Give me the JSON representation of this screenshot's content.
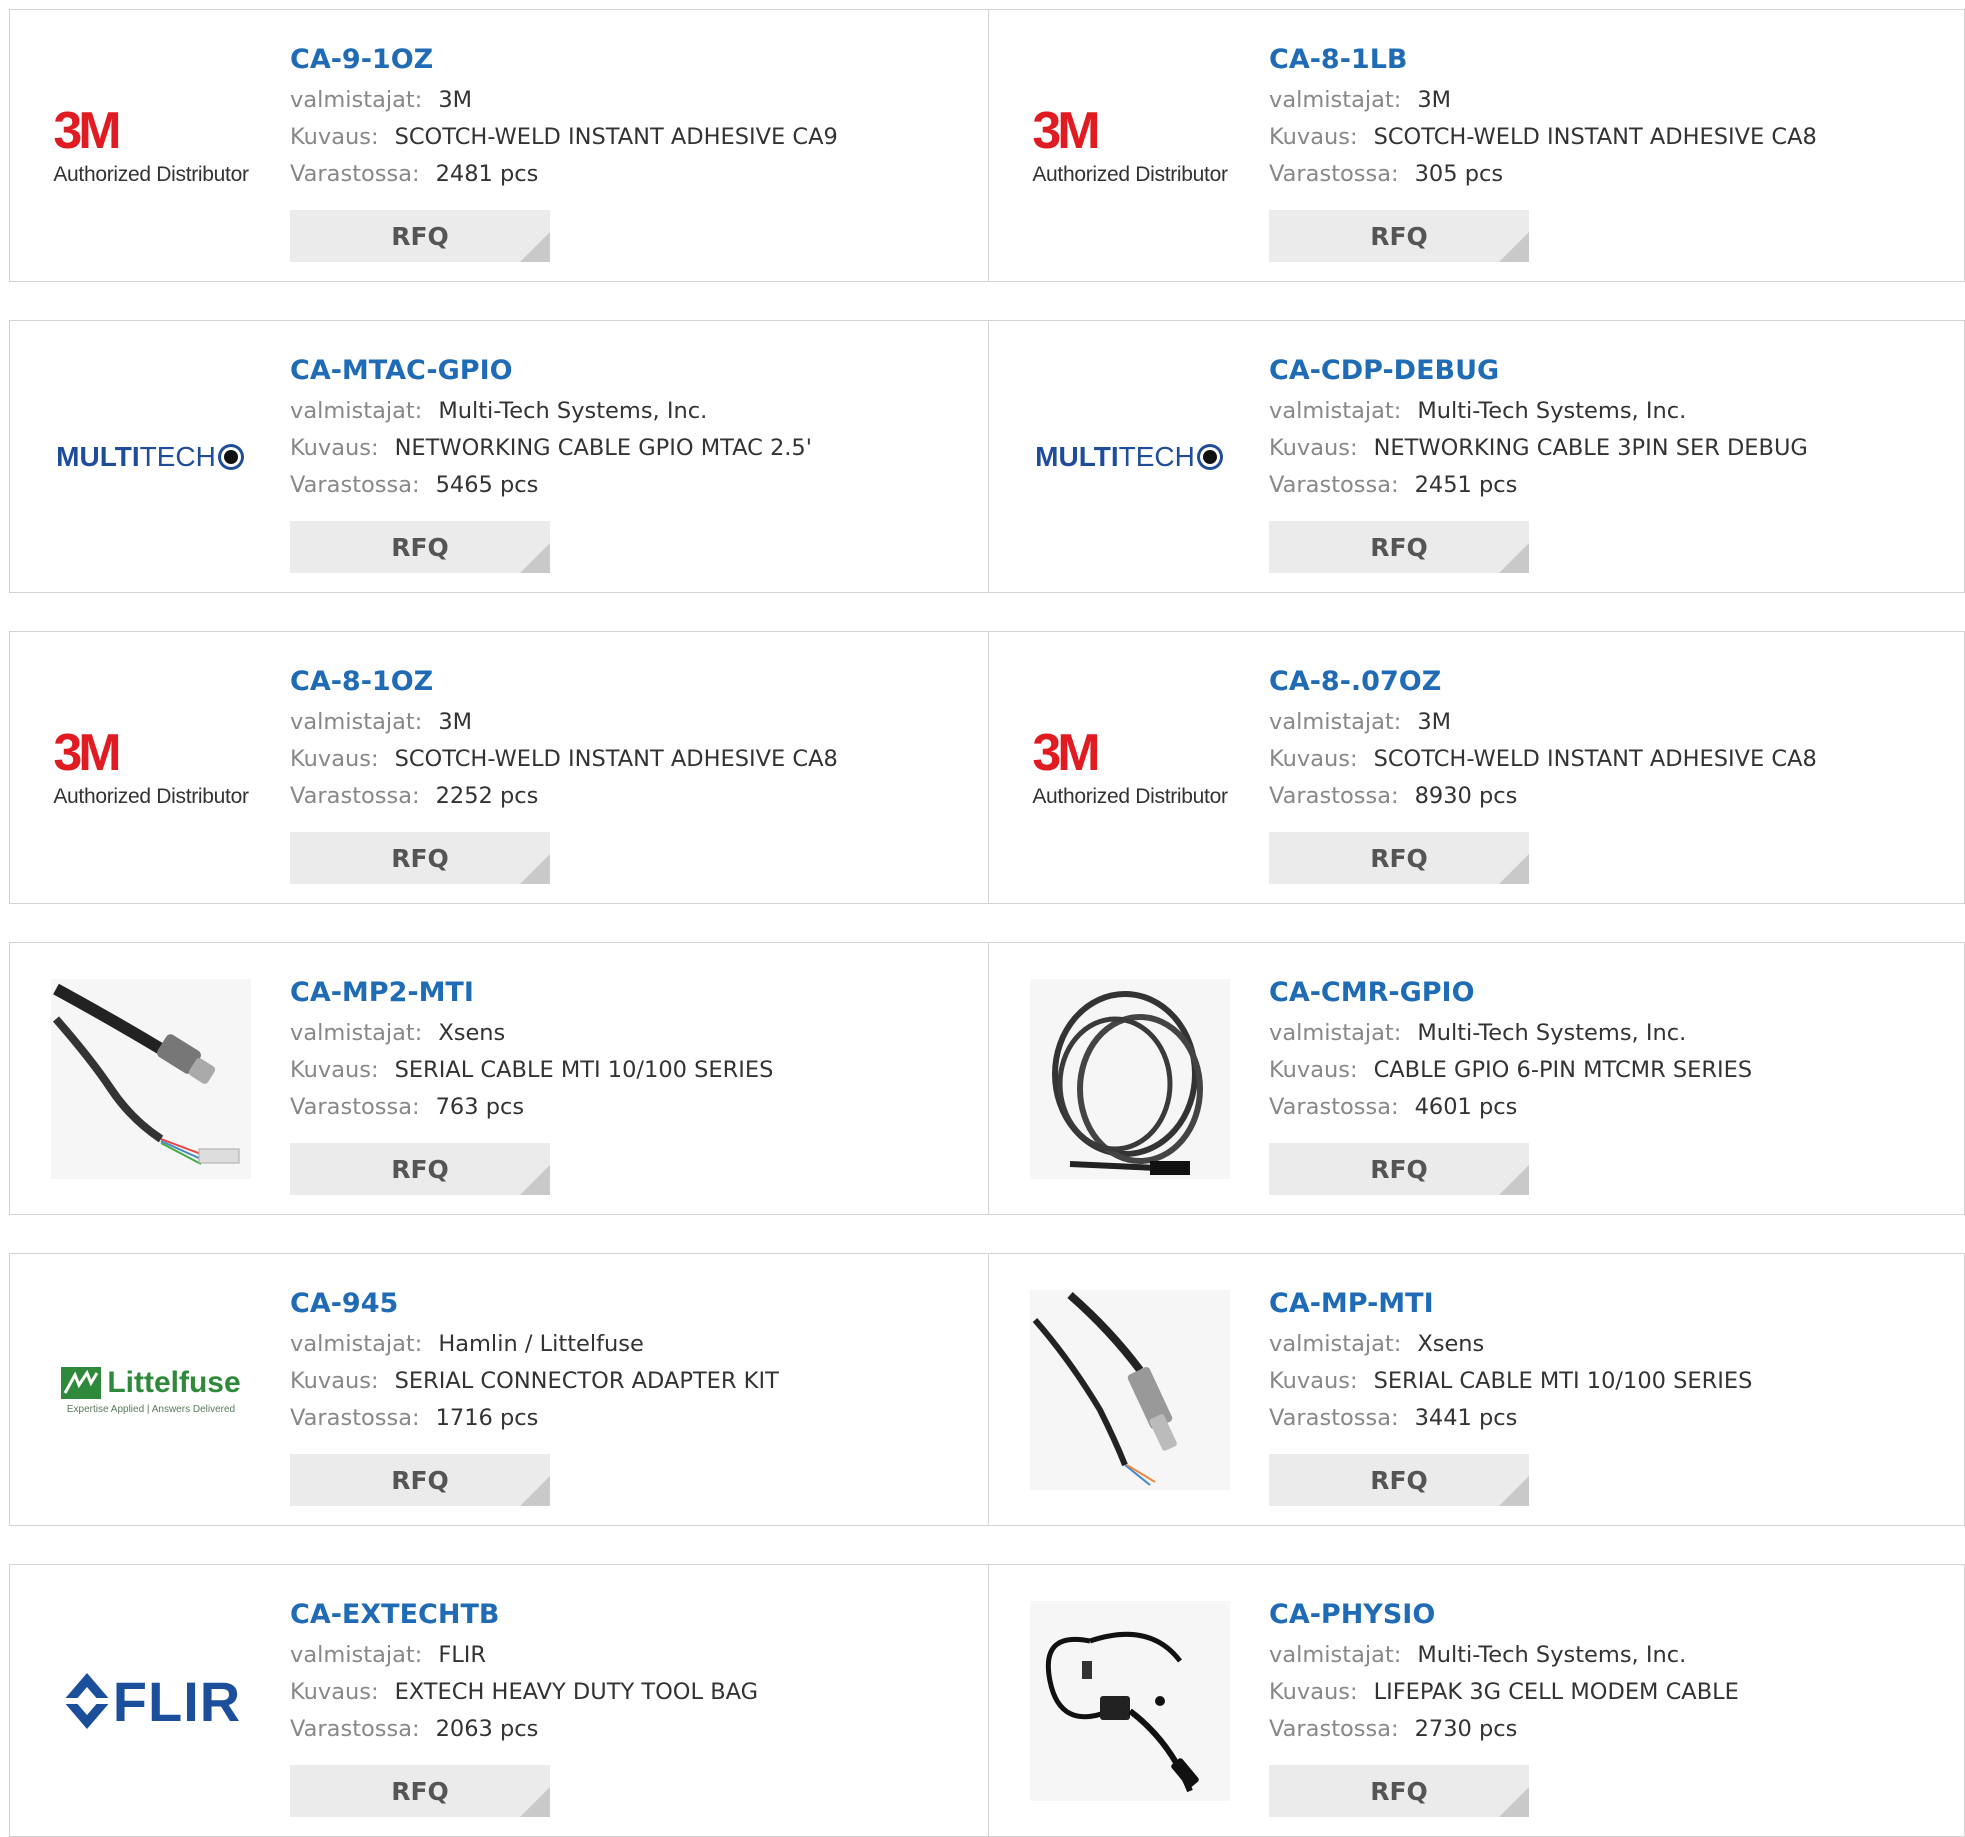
{
  "labels": {
    "manufacturer": "valmistajat:",
    "description": "Kuvaus:",
    "stock": "Varastossa:",
    "rfq": "RFQ"
  },
  "products": [
    {
      "pn": "CA-9-1OZ",
      "manufacturer": "3M",
      "description": "SCOTCH-WELD INSTANT ADHESIVE CA9",
      "stock": "2481 pcs",
      "logo": "3m-logo",
      "logo_text": [
        "3M",
        "Authorized Distributor"
      ]
    },
    {
      "pn": "CA-8-1LB",
      "manufacturer": "3M",
      "description": "SCOTCH-WELD INSTANT ADHESIVE CA8",
      "stock": "305 pcs",
      "logo": "3m-logo",
      "logo_text": [
        "3M",
        "Authorized Distributor"
      ]
    },
    {
      "pn": "CA-MTAC-GPIO",
      "manufacturer": "Multi-Tech Systems, Inc.",
      "description": "NETWORKING CABLE GPIO MTAC 2.5'",
      "stock": "5465 pcs",
      "logo": "multitech-logo",
      "logo_text": [
        "MULTI",
        "TECH"
      ]
    },
    {
      "pn": "CA-CDP-DEBUG",
      "manufacturer": "Multi-Tech Systems, Inc.",
      "description": "NETWORKING CABLE 3PIN SER DEBUG",
      "stock": "2451 pcs",
      "logo": "multitech-logo",
      "logo_text": [
        "MULTI",
        "TECH"
      ]
    },
    {
      "pn": "CA-8-1OZ",
      "manufacturer": "3M",
      "description": "SCOTCH-WELD INSTANT ADHESIVE CA8",
      "stock": "2252 pcs",
      "logo": "3m-logo",
      "logo_text": [
        "3M",
        "Authorized Distributor"
      ]
    },
    {
      "pn": "CA-8-.07OZ",
      "manufacturer": "3M",
      "description": "SCOTCH-WELD INSTANT ADHESIVE CA8",
      "stock": "8930 pcs",
      "logo": "3m-logo",
      "logo_text": [
        "3M",
        "Authorized Distributor"
      ]
    },
    {
      "pn": "CA-MP2-MTI",
      "manufacturer": "Xsens",
      "description": "SERIAL CABLE MTI 10/100 SERIES",
      "stock": "763 pcs",
      "logo": "cable-photo-a"
    },
    {
      "pn": "CA-CMR-GPIO",
      "manufacturer": "Multi-Tech Systems, Inc.",
      "description": "CABLE GPIO 6-PIN MTCMR SERIES",
      "stock": "4601 pcs",
      "logo": "coiled-cable-photo"
    },
    {
      "pn": "CA-945",
      "manufacturer": "Hamlin / Littelfuse",
      "description": "SERIAL CONNECTOR ADAPTER KIT",
      "stock": "1716 pcs",
      "logo": "littelfuse-logo",
      "logo_text": [
        "Littelfuse",
        "Expertise Applied | Answers Delivered"
      ]
    },
    {
      "pn": "CA-MP-MTI",
      "manufacturer": "Xsens",
      "description": "SERIAL CABLE MTI 10/100 SERIES",
      "stock": "3441 pcs",
      "logo": "cable-photo-b"
    },
    {
      "pn": "CA-EXTECHTB",
      "manufacturer": "FLIR",
      "description": "EXTECH HEAVY DUTY TOOL BAG",
      "stock": "2063 pcs",
      "logo": "flir-logo",
      "logo_text": [
        "FLIR"
      ]
    },
    {
      "pn": "CA-PHYSIO",
      "manufacturer": "Multi-Tech Systems, Inc.",
      "description": "LIFEPAK 3G CELL MODEM CABLE",
      "stock": "2730 pcs",
      "logo": "modem-cable-photo"
    }
  ]
}
